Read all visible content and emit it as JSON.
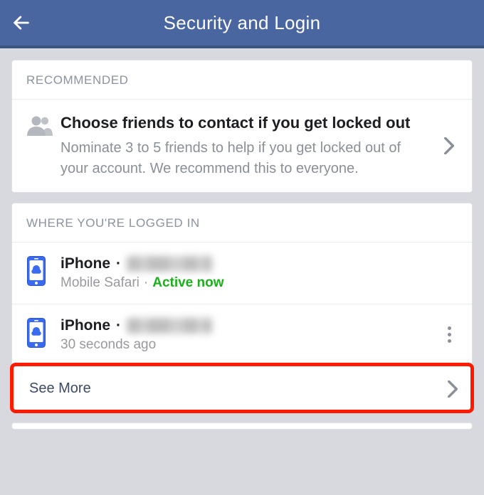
{
  "header": {
    "title": "Security and Login"
  },
  "recommended": {
    "section_label": "RECOMMENDED",
    "item": {
      "title": "Choose friends to contact if you get locked out",
      "subtitle": "Nominate 3 to 5 friends to help if you get locked out of your account. We recommend this to everyone."
    }
  },
  "sessions": {
    "section_label": "WHERE YOU'RE LOGGED IN",
    "items": [
      {
        "device": "iPhone",
        "browser": "Mobile Safari",
        "status": "Active now",
        "active": true
      },
      {
        "device": "iPhone",
        "timestamp": "30 seconds ago",
        "active": false
      }
    ],
    "see_more_label": "See More"
  }
}
